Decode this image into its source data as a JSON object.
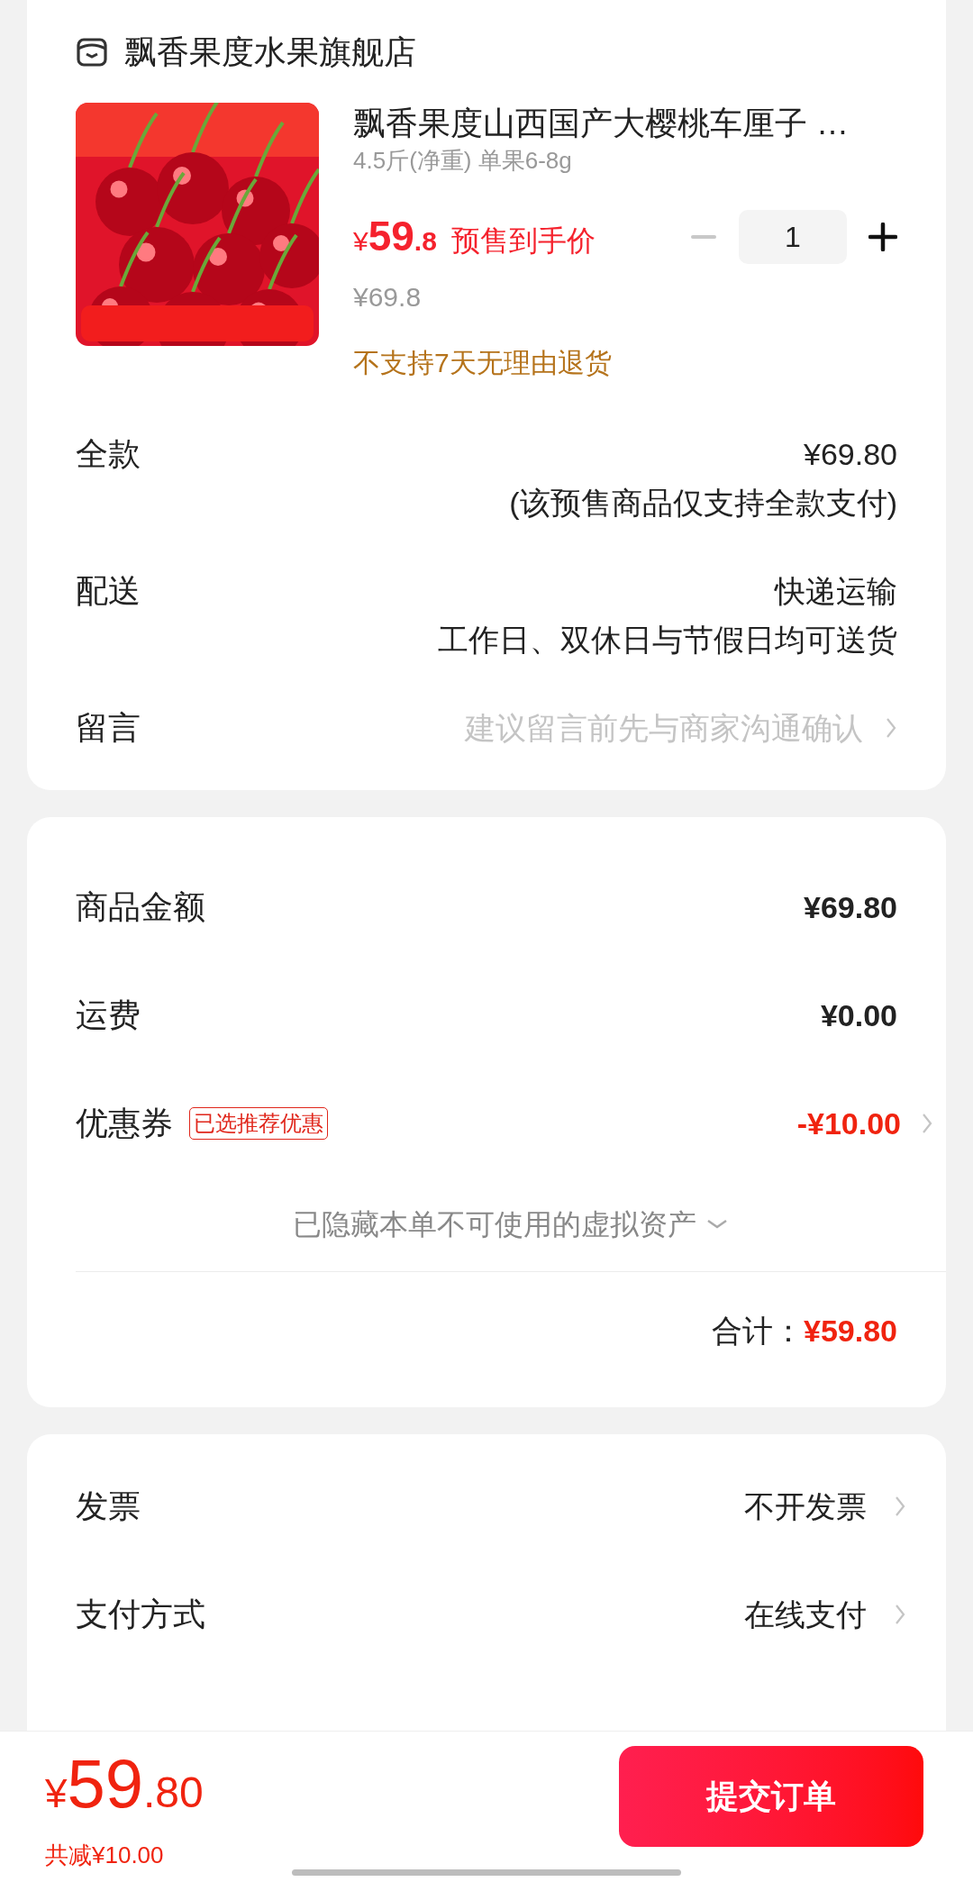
{
  "shop": {
    "name": "飘香果度水果旗舰店"
  },
  "product": {
    "title": "飘香果度山西国产大樱桃车厘子 …",
    "spec": "4.5斤(净重) 单果6-8g",
    "price_symbol": "¥",
    "price_int": "59",
    "price_dec": ".8",
    "price_label": "预售到手价",
    "original_price": "¥69.8",
    "quantity": "1",
    "decrease_disabled": true,
    "notice": "不支持7天无理由退货"
  },
  "order_rows": [
    {
      "kind": "value",
      "label": "全款",
      "value": "¥69.80",
      "note": "(该预售商品仅支持全款支付)"
    },
    {
      "kind": "value",
      "label": "配送",
      "value": "快递运输",
      "note": "工作日、双休日与节假日均可送货"
    },
    {
      "kind": "input",
      "label": "留言",
      "placeholder": "建议留言前先与商家沟通确认"
    }
  ],
  "summary": {
    "rows": [
      {
        "kind": "amount",
        "label": "商品金额",
        "value": "¥69.80"
      },
      {
        "kind": "amount",
        "label": "运费",
        "value": "¥0.00"
      },
      {
        "kind": "coupon",
        "label": "优惠券",
        "badge": "已选推荐优惠",
        "value": "-¥10.00"
      }
    ],
    "hidden_assets": "已隐藏本单不可使用的虚拟资产",
    "total_label": "合计：",
    "total_value": "¥59.80"
  },
  "options": [
    {
      "label": "发票",
      "value": "不开发票"
    },
    {
      "label": "支付方式",
      "value": "在线支付"
    }
  ],
  "footer": {
    "price_symbol": "¥",
    "price_int": "59",
    "price_dec": ".80",
    "discount": "共减¥10.00",
    "submit": "提交订单"
  }
}
